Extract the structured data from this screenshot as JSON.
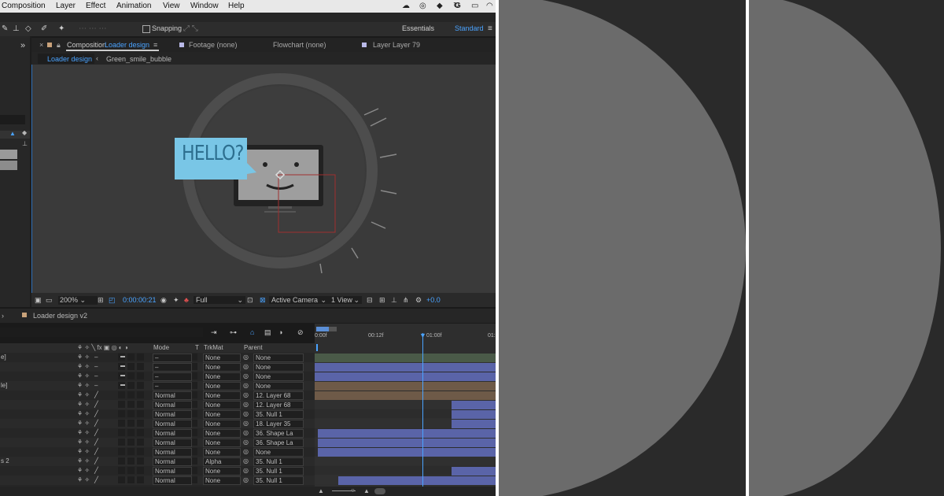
{
  "menubar": {
    "items": [
      "Composition",
      "Layer",
      "Effect",
      "Animation",
      "View",
      "Window",
      "Help"
    ],
    "tray_icons": [
      "cloud-icon",
      "creative-cloud-icon",
      "dropbox-icon",
      "sync-icon",
      "google-icon",
      "airplay-icon",
      "wifi-icon"
    ],
    "google_letter": "G"
  },
  "toolbar": {
    "snapping_label": "Snapping",
    "workspaces": [
      "Essentials",
      "Standard"
    ],
    "active_workspace": "Standard"
  },
  "comp_tabs": {
    "composition_prefix": "Composition",
    "composition_name": "Loader design",
    "footage": "Footage (none)",
    "flowchart": "Flowchart (none)",
    "layer": "Layer Layer 79"
  },
  "viewer_tabs": [
    "Loader design",
    "Green_smile_bubble"
  ],
  "viewer": {
    "bubble_text": "HELLO?"
  },
  "viewer_bar": {
    "zoom": "200%",
    "timecode": "0:00:00:21",
    "resolution": "Full",
    "camera": "Active Camera",
    "views": "1 View",
    "exposure": "+0.0"
  },
  "timeline": {
    "comp_tab": "Loader design v2",
    "ruler_labels": [
      "0:00f",
      "00:12f",
      "01:00f",
      "01:"
    ],
    "columns": {
      "mode": "Mode",
      "t": "T",
      "trkmat": "TrkMat",
      "parent": "Parent"
    },
    "layers": [
      {
        "name": "e]",
        "mode": "–",
        "trkmat": "None",
        "parent": "None"
      },
      {
        "name": "",
        "mode": "–",
        "trkmat": "None",
        "parent": "None"
      },
      {
        "name": "",
        "mode": "–",
        "trkmat": "None",
        "parent": "None"
      },
      {
        "name": "le]",
        "mode": "–",
        "trkmat": "None",
        "parent": "None"
      },
      {
        "name": "",
        "mode": "Normal",
        "trkmat": "None",
        "parent": "12. Layer 68"
      },
      {
        "name": "",
        "mode": "Normal",
        "trkmat": "None",
        "parent": "12. Layer 68"
      },
      {
        "name": "",
        "mode": "Normal",
        "trkmat": "None",
        "parent": "35. Null 1"
      },
      {
        "name": "",
        "mode": "Normal",
        "trkmat": "None",
        "parent": "18. Layer 35"
      },
      {
        "name": "",
        "mode": "Normal",
        "trkmat": "None",
        "parent": "36. Shape La"
      },
      {
        "name": "",
        "mode": "Normal",
        "trkmat": "None",
        "parent": "36. Shape La"
      },
      {
        "name": "",
        "mode": "Normal",
        "trkmat": "None",
        "parent": "None"
      },
      {
        "name": "s 2",
        "mode": "Normal",
        "trkmat": "Alpha",
        "parent": "35. Null 1"
      },
      {
        "name": "",
        "mode": "Normal",
        "trkmat": "None",
        "parent": "35. Null 1"
      },
      {
        "name": "",
        "mode": "Normal",
        "trkmat": "None",
        "parent": "35. Null 1"
      }
    ]
  },
  "colors": {
    "accent_blue": "#4aa3ff",
    "track_purple": "#5a64a8",
    "track_green": "#4a5a48",
    "track_tan": "#6e5a48",
    "bubble_blue": "#79c6e6",
    "circle_gray": "#6b6b6b"
  }
}
